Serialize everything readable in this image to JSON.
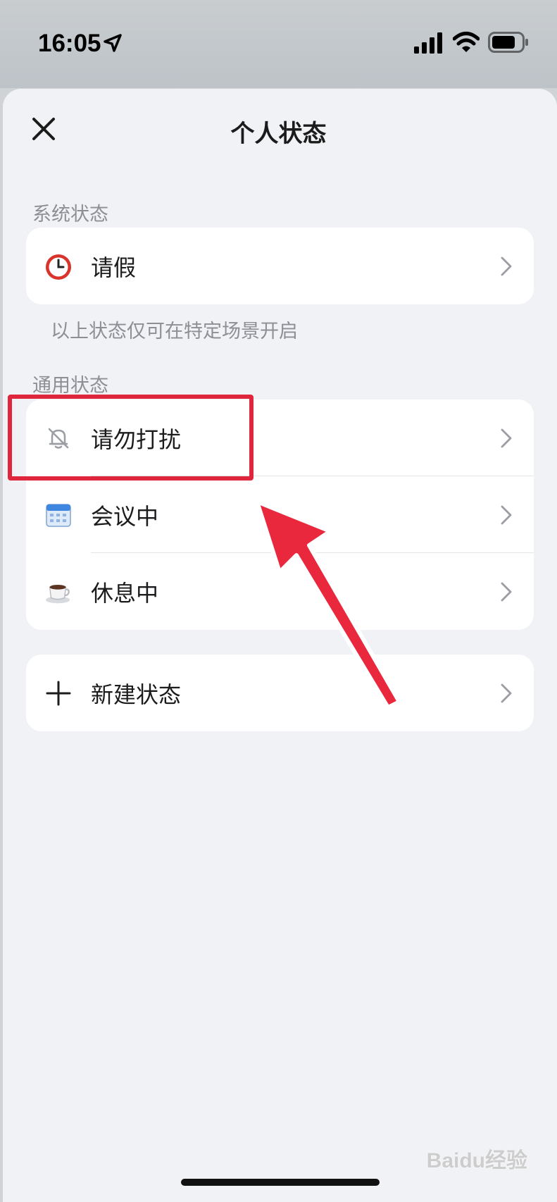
{
  "status_bar": {
    "time": "16:05"
  },
  "header": {
    "title": "个人状态"
  },
  "system_section": {
    "label": "系统状态",
    "items": [
      {
        "label": "请假",
        "icon": "alarm-clock-icon"
      }
    ],
    "hint": "以上状态仅可在特定场景开启"
  },
  "general_section": {
    "label": "通用状态",
    "items": [
      {
        "label": "请勿打扰",
        "icon": "bell-off-icon"
      },
      {
        "label": "会议中",
        "icon": "calendar-icon"
      },
      {
        "label": "休息中",
        "icon": "coffee-cup-icon"
      }
    ]
  },
  "new_status": {
    "label": "新建状态",
    "icon": "plus-icon"
  },
  "watermark": {
    "text": "Baidu经验"
  },
  "colors": {
    "highlight": "#e0263d",
    "background": "#f1f2f5"
  }
}
